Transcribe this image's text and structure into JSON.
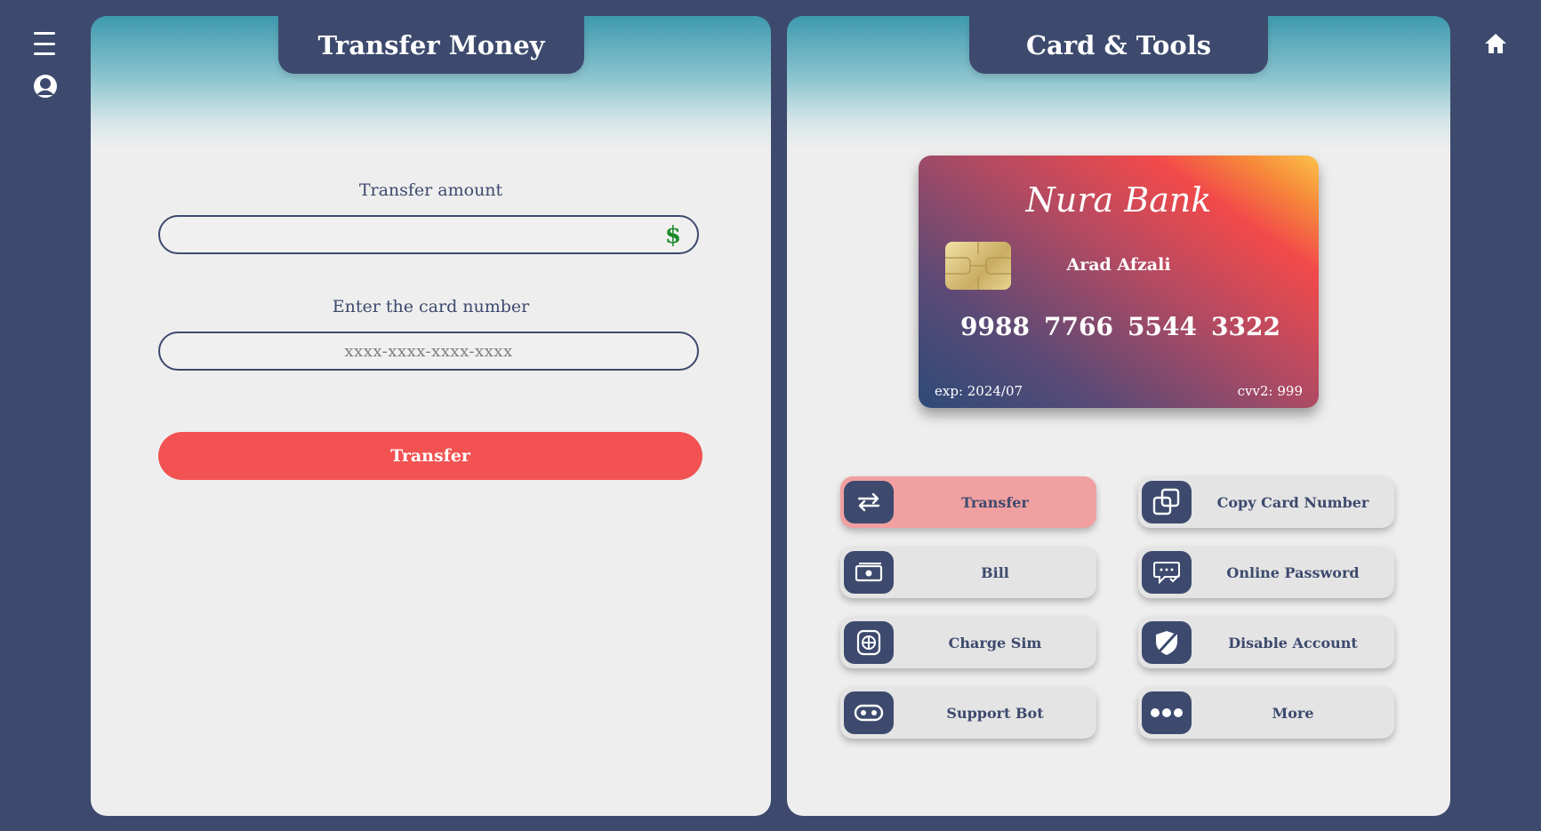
{
  "sidebar": {
    "menu_icon": "hamburger-icon",
    "profile_icon": "user-avatar-icon"
  },
  "topbar": {
    "home_icon": "home-icon"
  },
  "transfer_panel": {
    "title": "Transfer Money",
    "amount_label": "Transfer amount",
    "amount_value": "",
    "currency_symbol": "$",
    "card_label": "Enter the card number",
    "card_placeholder": "xxxx-xxxx-xxxx-xxxx",
    "card_value": "",
    "submit_label": "Transfer"
  },
  "tools_panel": {
    "title": "Card & Tools",
    "card": {
      "bank_name": "Nura Bank",
      "holder": "Arad Afzali",
      "number_groups": [
        "9988",
        "7766",
        "5544",
        "3322"
      ],
      "expiry": "exp: 2024/07",
      "cvv": "cvv2: 999"
    },
    "tools": [
      {
        "label": "Transfer",
        "icon": "transfer-icon",
        "active": true
      },
      {
        "label": "Copy Card Number",
        "icon": "copy-icon",
        "active": false
      },
      {
        "label": "Bill",
        "icon": "bill-icon",
        "active": false
      },
      {
        "label": "Online Password",
        "icon": "password-icon",
        "active": false
      },
      {
        "label": "Charge Sim",
        "icon": "sim-icon",
        "active": false
      },
      {
        "label": "Disable Account",
        "icon": "disable-icon",
        "active": false
      },
      {
        "label": "Support Bot",
        "icon": "bot-icon",
        "active": false
      },
      {
        "label": "More",
        "icon": "more-icon",
        "active": false
      }
    ]
  },
  "colors": {
    "background": "#3d4a6e",
    "accent": "#f25252",
    "active_tool": "#f0a0a0"
  }
}
